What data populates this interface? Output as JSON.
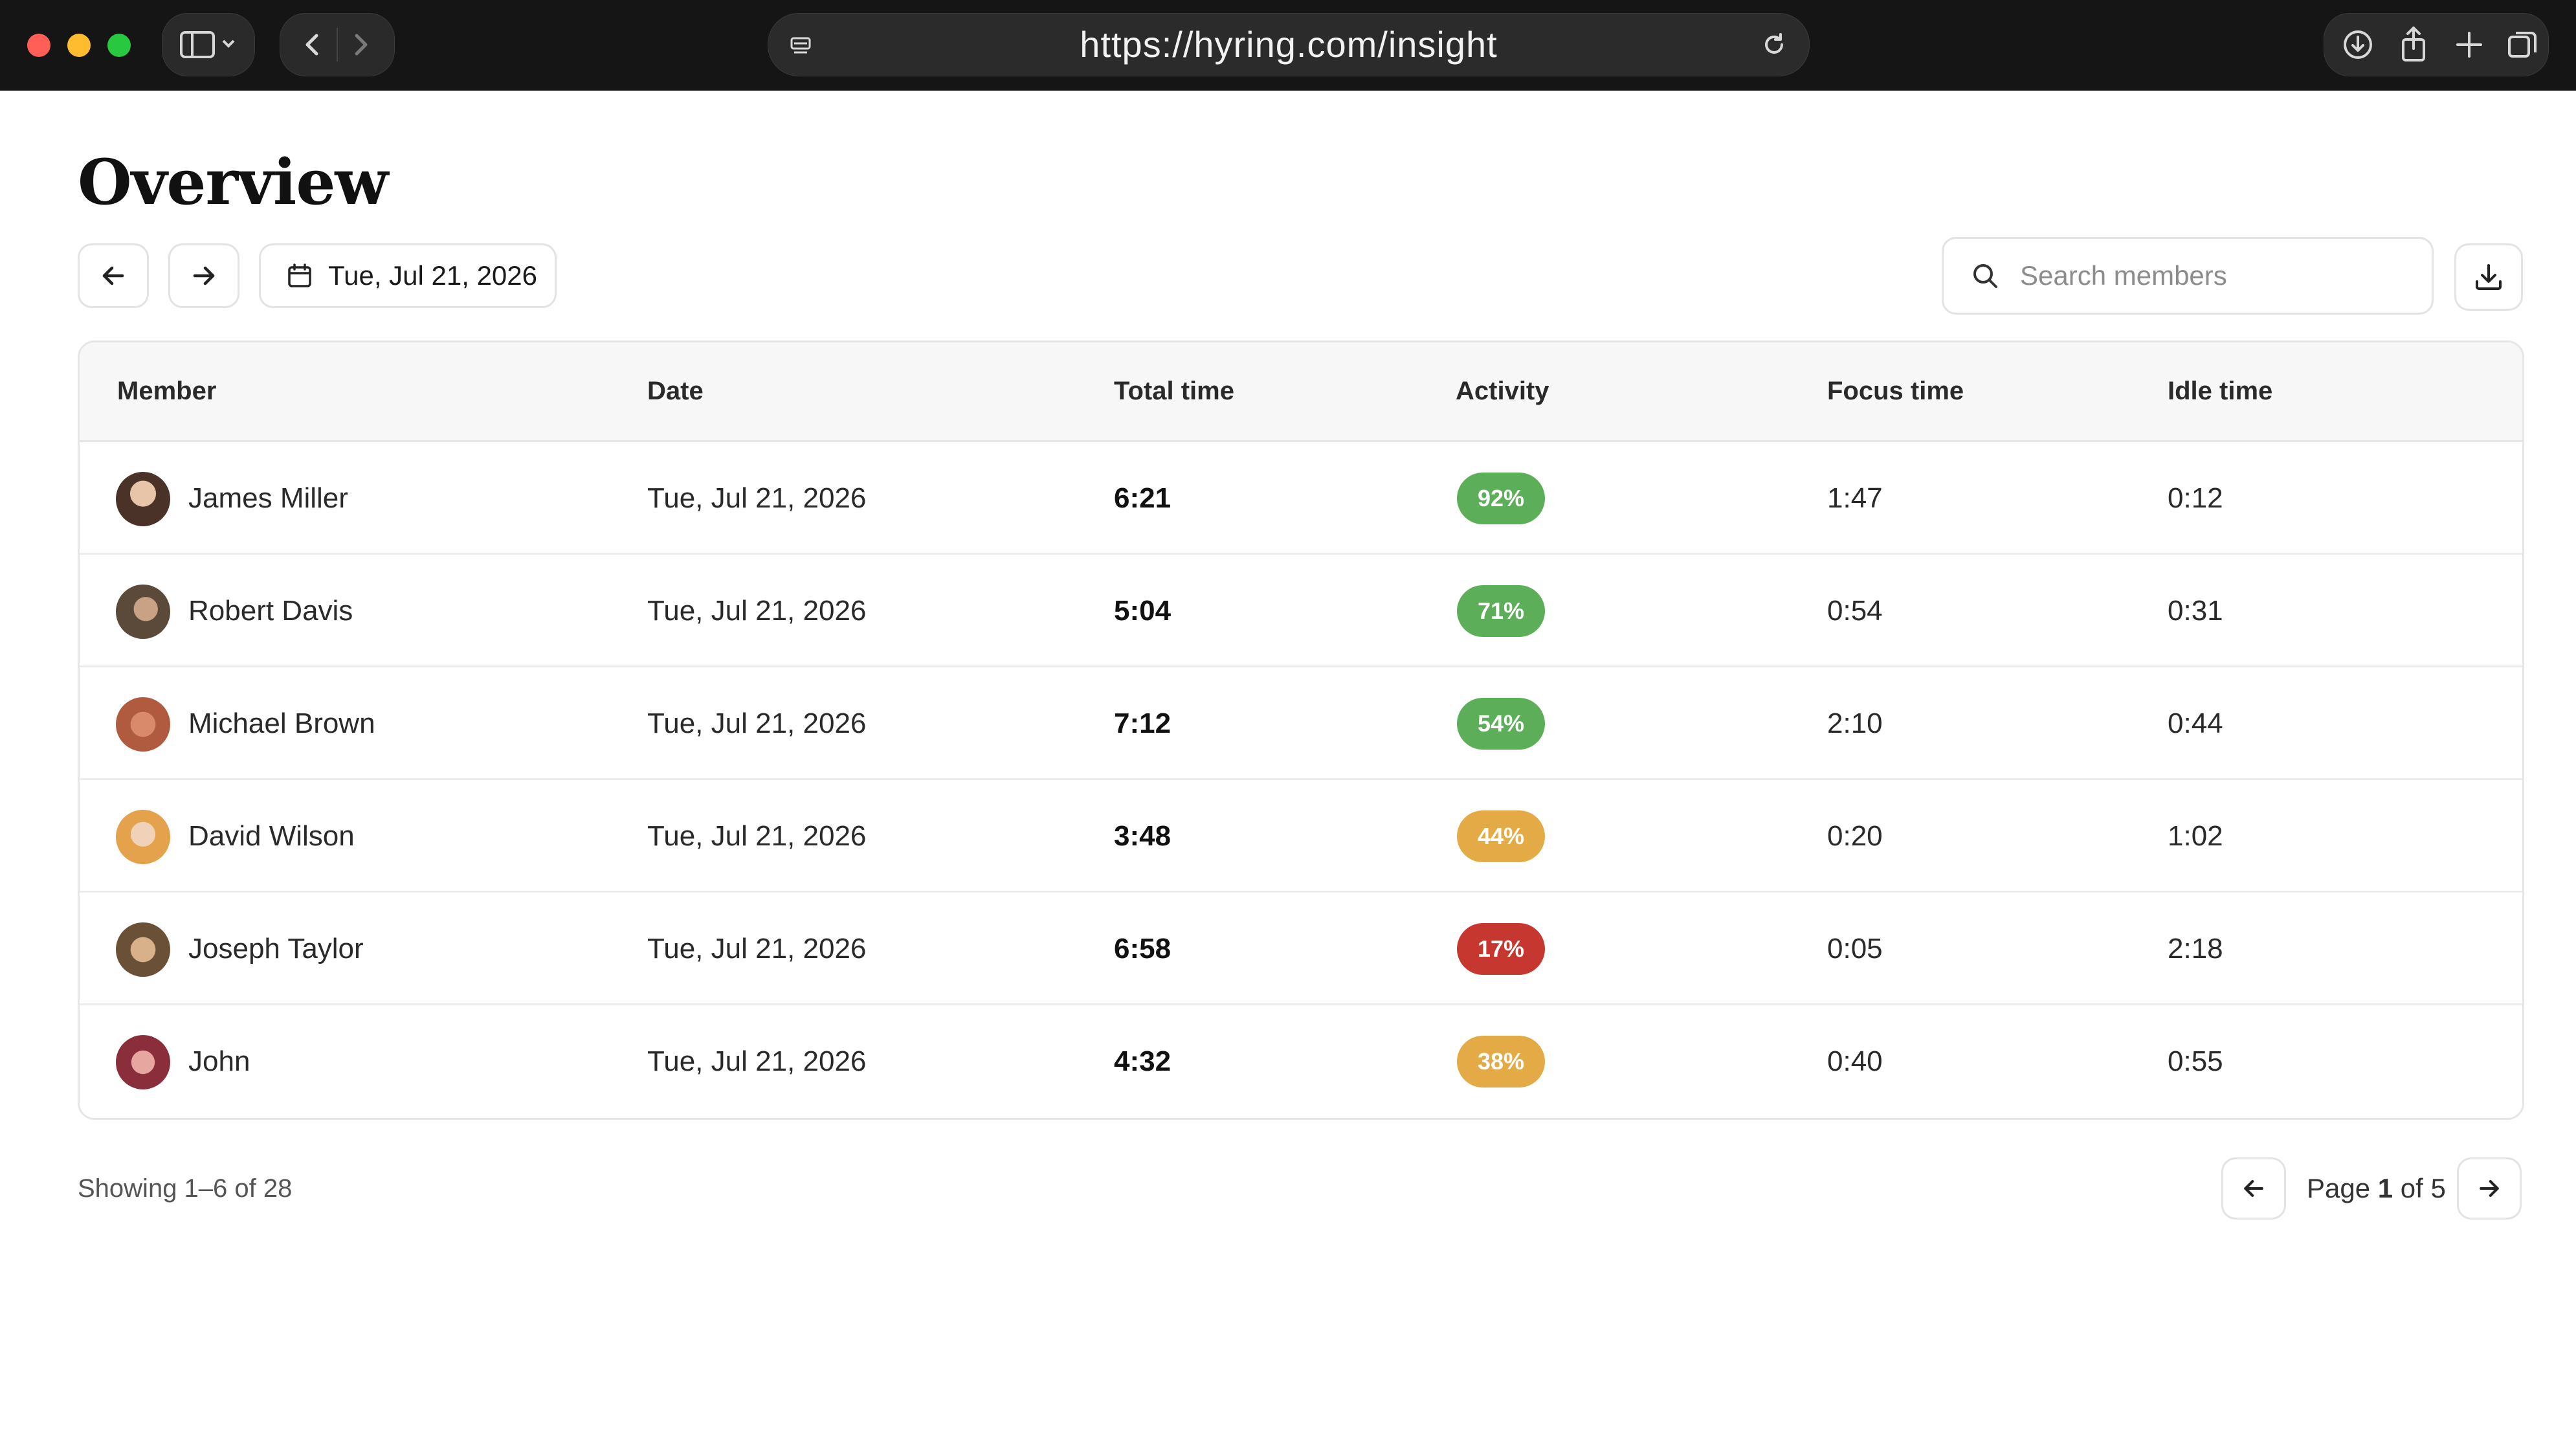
{
  "browser": {
    "url": "https://hyring.com/insight",
    "traffic_colors": [
      "#ff5f57",
      "#febc2e",
      "#28c840"
    ]
  },
  "page": {
    "title": "Overview",
    "date_label": "Tue, Jul 21, 2026",
    "search_placeholder": "Search members"
  },
  "table": {
    "headers": [
      "Member",
      "Date",
      "Total time",
      "Activity",
      "Focus time",
      "Idle time"
    ],
    "rows": [
      {
        "member": "James Miller",
        "date": "Tue, Jul 21, 2026",
        "total": "6:21",
        "activity": "92%",
        "activity_color": "#5cae59",
        "focus": "1:47",
        "idle": "0:12"
      },
      {
        "member": "Robert Davis",
        "date": "Tue, Jul 21, 2026",
        "total": "5:04",
        "activity": "71%",
        "activity_color": "#5cae59",
        "focus": "0:54",
        "idle": "0:31"
      },
      {
        "member": "Michael Brown",
        "date": "Tue, Jul 21, 2026",
        "total": "7:12",
        "activity": "54%",
        "activity_color": "#5cae59",
        "focus": "2:10",
        "idle": "0:44"
      },
      {
        "member": "David Wilson",
        "date": "Tue, Jul 21, 2026",
        "total": "3:48",
        "activity": "44%",
        "activity_color": "#e3aa45",
        "focus": "0:20",
        "idle": "1:02"
      },
      {
        "member": "Joseph Taylor",
        "date": "Tue, Jul 21, 2026",
        "total": "6:58",
        "activity": "17%",
        "activity_color": "#c6372f",
        "focus": "0:05",
        "idle": "2:18"
      },
      {
        "member": "John",
        "date": "Tue, Jul 21, 2026",
        "total": "4:32",
        "activity": "38%",
        "activity_color": "#e3aa45",
        "focus": "0:40",
        "idle": "0:55"
      }
    ]
  },
  "footer": {
    "showing": "Showing 1–6 of 28",
    "page_prefix": "Page",
    "page_current": "1",
    "page_mid": "of",
    "page_total": "5"
  }
}
